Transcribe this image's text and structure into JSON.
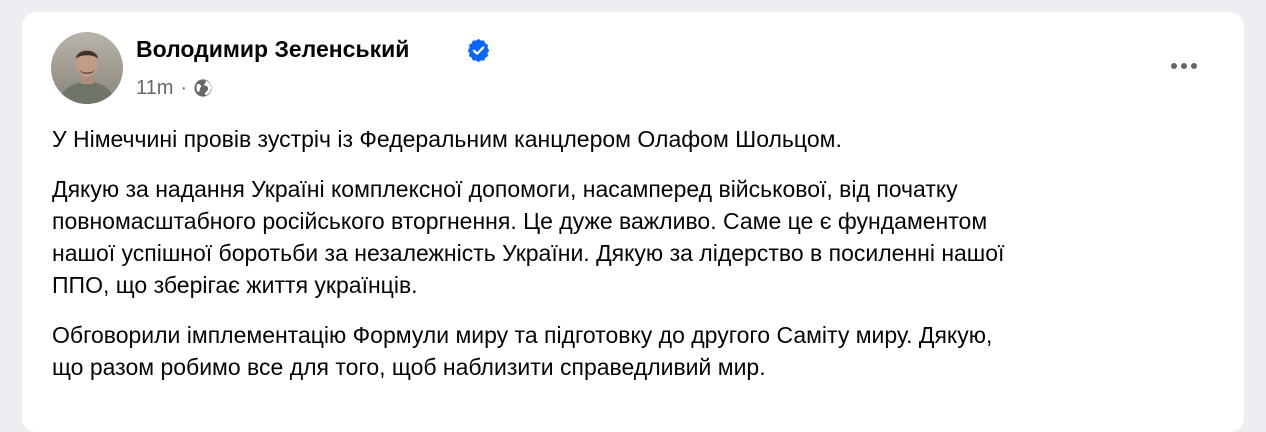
{
  "post": {
    "author": "Володимир Зеленський",
    "timestamp": "11m",
    "separator": "·",
    "audience_icon": "globe-icon",
    "verified_icon": "verified-badge-icon",
    "more_icon": "more-options-icon",
    "paragraphs": [
      {
        "lines": [
          "У Німеччині провів зустріч із Федеральним канцлером Олафом Шольцом."
        ]
      },
      {
        "lines": [
          "Дякую за надання Україні комплексної допомоги, насамперед військової, від початку",
          "повномасштабного російського вторгнення. Це дуже важливо. Саме це є фундаментом",
          "нашої успішної боротьби за незалежність України. Дякую за лідерство в посиленні нашої",
          "ППО, що зберігає життя українців."
        ]
      },
      {
        "lines": [
          "Обговорили імплементацію Формули миру та підготовку до другого Саміту миру. Дякую,",
          "що разом робимо все для того, щоб наблизити справедливий мир."
        ]
      }
    ]
  },
  "colors": {
    "page_bg": "#eceef1",
    "card_bg": "#ffffff",
    "text_primary": "#050505",
    "text_secondary": "#65676b",
    "verified_blue": "#0866ff"
  }
}
